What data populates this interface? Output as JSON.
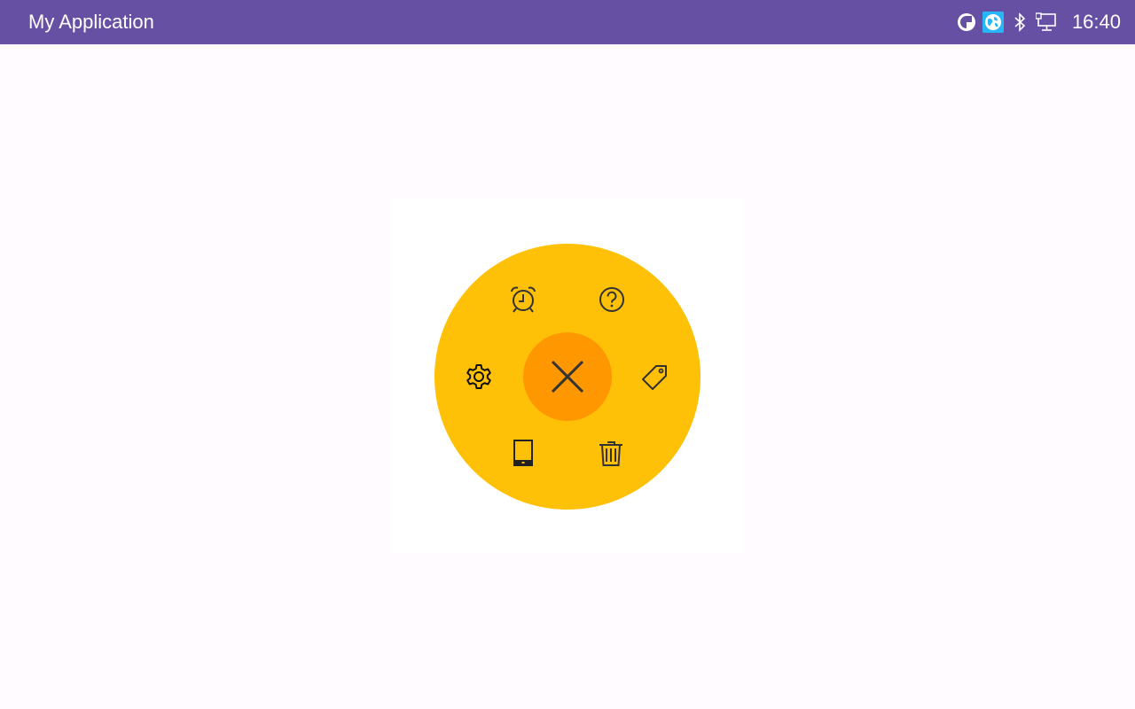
{
  "app": {
    "title": "My Application"
  },
  "status_bar": {
    "time": "16:40",
    "icons": [
      "data-saver-icon",
      "globe-vpn-icon",
      "bluetooth-icon",
      "ethernet-monitor-icon"
    ],
    "background_color": "#6650a4"
  },
  "radial_menu": {
    "state": "open",
    "wheel_color": "#ffc107",
    "center_color": "#ff9800",
    "center_icon": "close-icon",
    "items": [
      "alarm-clock-icon",
      "help-question-icon",
      "tag-icon",
      "trash-icon",
      "tablet-icon",
      "settings-gear-icon"
    ]
  }
}
